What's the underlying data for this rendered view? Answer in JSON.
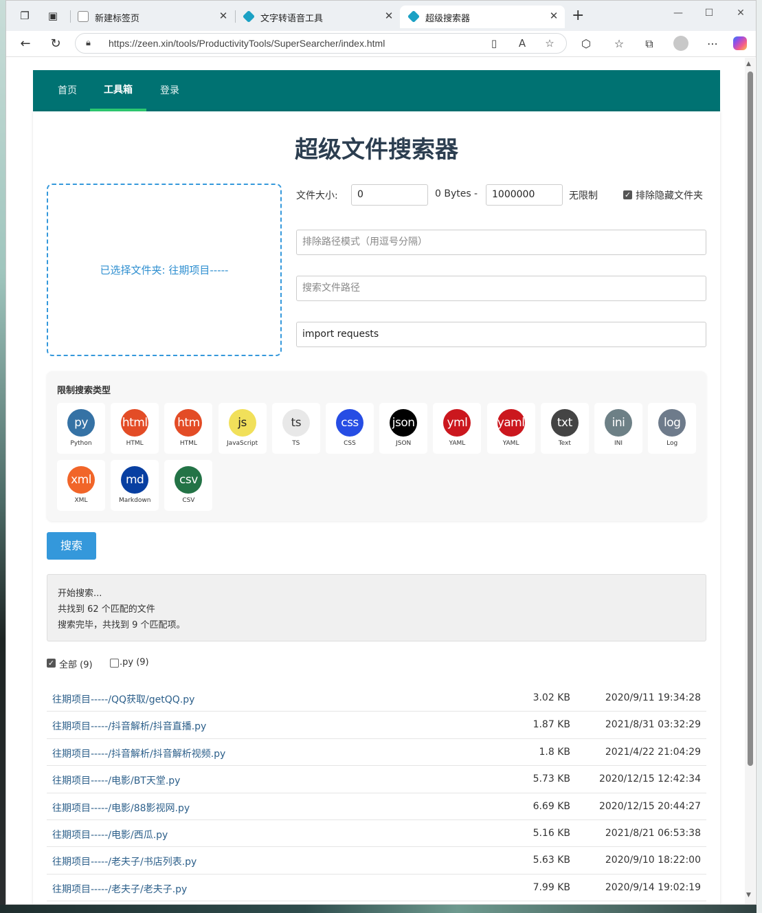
{
  "browser": {
    "tabs": [
      {
        "label": "新建标签页"
      },
      {
        "label": "文字转语音工具"
      },
      {
        "label": "超级搜索器"
      }
    ],
    "url": "https://zeen.xin/tools/ProductivityTools/SuperSearcher/index.html"
  },
  "nav": {
    "items": [
      {
        "label": "首页"
      },
      {
        "label": "工具箱"
      },
      {
        "label": "登录"
      }
    ]
  },
  "page": {
    "title": "超级文件搜索器",
    "dropzone_text": "已选择文件夹: 往期项目-----",
    "size_label": "文件大小:",
    "size_min": "0",
    "size_min_text": "0 Bytes",
    "size_dash": "-",
    "size_max": "1000000",
    "size_max_text": "无限制",
    "exclude_hidden_label": "排除隐藏文件夹",
    "exclude_path_placeholder": "排除路径模式（用逗号分隔）",
    "search_path_placeholder": "搜索文件路径",
    "search_query": "import requests",
    "types_title": "限制搜索类型",
    "file_types": [
      {
        "abbr": "py",
        "name": "Python",
        "color": "#3572a5",
        "text": "#fff"
      },
      {
        "abbr": "html",
        "name": "HTML",
        "color": "#e34c26",
        "text": "#fff"
      },
      {
        "abbr": "htm",
        "name": "HTML",
        "color": "#e34c26",
        "text": "#fff"
      },
      {
        "abbr": "js",
        "name": "JavaScript",
        "color": "#f1e05a",
        "text": "#222"
      },
      {
        "abbr": "ts",
        "name": "TS",
        "color": "#e8e8e8",
        "text": "#333"
      },
      {
        "abbr": "css",
        "name": "CSS",
        "color": "#264de4",
        "text": "#fff"
      },
      {
        "abbr": "json",
        "name": "JSON",
        "color": "#000000",
        "text": "#fff"
      },
      {
        "abbr": "yml",
        "name": "YAML",
        "color": "#cb171e",
        "text": "#fff"
      },
      {
        "abbr": "yaml",
        "name": "YAML",
        "color": "#cb171e",
        "text": "#fff"
      },
      {
        "abbr": "txt",
        "name": "Text",
        "color": "#444444",
        "text": "#fff"
      },
      {
        "abbr": "ini",
        "name": "INI",
        "color": "#6d8086",
        "text": "#fff"
      },
      {
        "abbr": "log",
        "name": "Log",
        "color": "#6e7b8b",
        "text": "#fff"
      },
      {
        "abbr": "xml",
        "name": "XML",
        "color": "#f16529",
        "text": "#fff"
      },
      {
        "abbr": "md",
        "name": "Markdown",
        "color": "#083fa1",
        "text": "#fff"
      },
      {
        "abbr": "csv",
        "name": "CSV",
        "color": "#237346",
        "text": "#fff"
      }
    ],
    "search_button": "搜索",
    "log_lines": [
      "开始搜索...",
      "共找到 62 个匹配的文件",
      "搜索完毕，共找到 9 个匹配项。"
    ],
    "filter_all": "全部 (9)",
    "filter_py": ".py (9)",
    "results": [
      {
        "path": "往期项目-----/QQ获取/getQQ.py",
        "size": "3.02 KB",
        "date": "2020/9/11 19:34:28"
      },
      {
        "path": "往期项目-----/抖音解析/抖音直播.py",
        "size": "1.87 KB",
        "date": "2021/8/31 03:32:29"
      },
      {
        "path": "往期项目-----/抖音解析/抖音解析视频.py",
        "size": "1.8 KB",
        "date": "2021/4/22 21:04:29"
      },
      {
        "path": "往期项目-----/电影/BT天堂.py",
        "size": "5.73 KB",
        "date": "2020/12/15 12:42:34"
      },
      {
        "path": "往期项目-----/电影/88影视网.py",
        "size": "6.69 KB",
        "date": "2020/12/15 20:44:27"
      },
      {
        "path": "往期项目-----/电影/西瓜.py",
        "size": "5.16 KB",
        "date": "2021/8/21 06:53:38"
      },
      {
        "path": "往期项目-----/老夫子/书店列表.py",
        "size": "5.63 KB",
        "date": "2020/9/10 18:22:00"
      },
      {
        "path": "往期项目-----/老夫子/老夫子.py",
        "size": "7.99 KB",
        "date": "2020/9/14 19:02:19"
      }
    ]
  }
}
